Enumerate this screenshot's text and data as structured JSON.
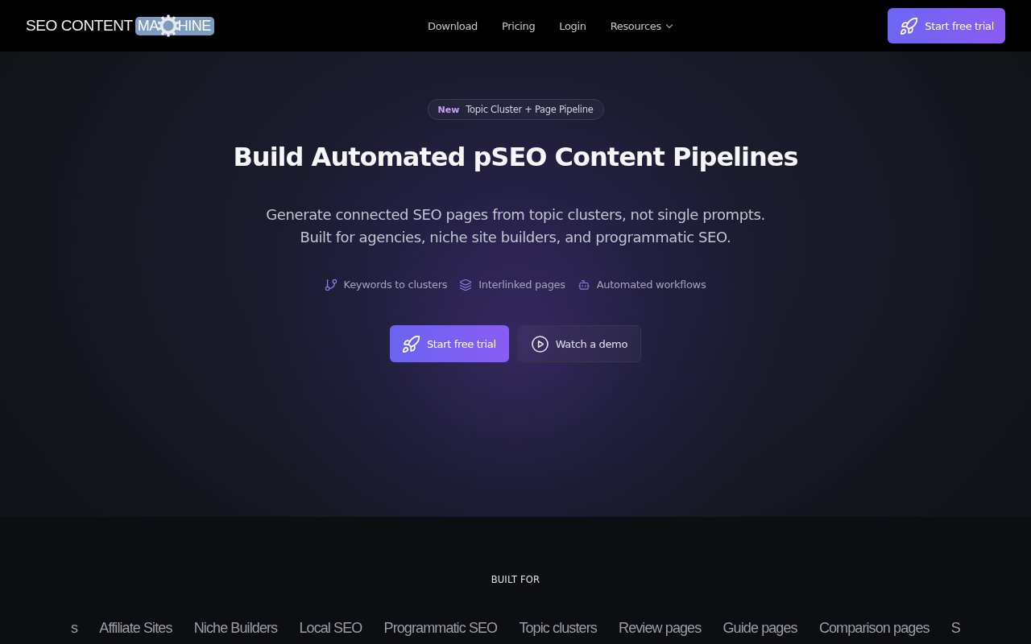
{
  "nav": {
    "logo": {
      "text": "SEO CONTENT",
      "badge_left": "MA",
      "badge_right": "HINE"
    },
    "links": [
      {
        "label": "Download",
        "kind": "link"
      },
      {
        "label": "Pricing",
        "kind": "link"
      },
      {
        "label": "Login",
        "kind": "link"
      },
      {
        "label": "Resources",
        "kind": "dropdown"
      }
    ],
    "cta": "Start free trial"
  },
  "hero": {
    "badge": {
      "tag": "New",
      "text": "Topic Cluster + Page Pipeline"
    },
    "title": "Build Automated pSEO Content Pipelines",
    "subtitle": [
      "Generate connected SEO pages from topic clusters, not single prompts.",
      "Built for agencies, niche site builders, and programmatic SEO."
    ],
    "features": [
      {
        "label": "Keywords to clusters"
      },
      {
        "label": "Interlinked pages"
      },
      {
        "label": "Automated workflows"
      }
    ],
    "buttons": [
      {
        "label": "Start free trial",
        "kind": "primary"
      },
      {
        "label": "Watch a demo",
        "kind": "secondary"
      }
    ]
  },
  "built_for": {
    "heading": "BUILT FOR",
    "items": [
      "s",
      "Affiliate Sites",
      "Niche Builders",
      "Local SEO",
      "Programmatic SEO",
      "Topic clusters",
      "Review pages",
      "Guide pages",
      "Comparison pages",
      "S"
    ]
  }
}
